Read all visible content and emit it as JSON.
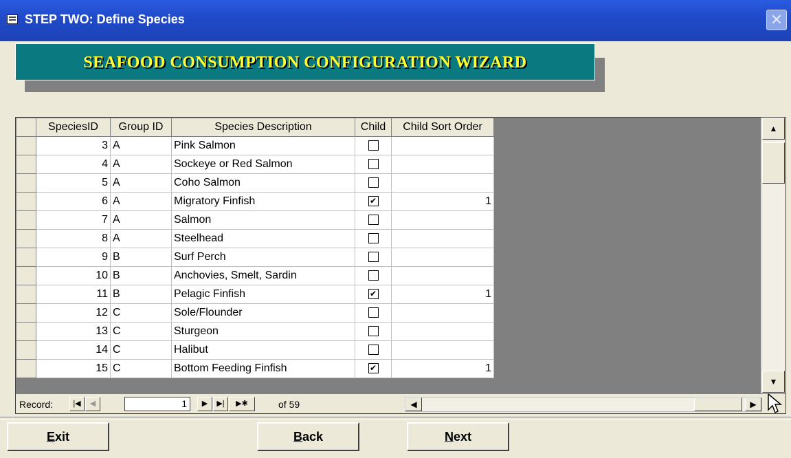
{
  "window": {
    "title": "STEP TWO:  Define Species",
    "close_label": "✕"
  },
  "banner": {
    "text": "SEAFOOD CONSUMPTION CONFIGURATION WIZARD"
  },
  "table": {
    "columns": [
      "SpeciesID",
      "Group ID",
      "Species Description",
      "Child",
      "Child Sort Order"
    ],
    "rows": [
      {
        "id": "3",
        "group": "A",
        "desc": "Pink Salmon",
        "child": false,
        "sort": ""
      },
      {
        "id": "4",
        "group": "A",
        "desc": "Sockeye or Red Salmon",
        "child": false,
        "sort": ""
      },
      {
        "id": "5",
        "group": "A",
        "desc": "Coho Salmon",
        "child": false,
        "sort": ""
      },
      {
        "id": "6",
        "group": "A",
        "desc": "Migratory Finfish",
        "child": true,
        "sort": "1"
      },
      {
        "id": "7",
        "group": "A",
        "desc": "Salmon",
        "child": false,
        "sort": ""
      },
      {
        "id": "8",
        "group": "A",
        "desc": "Steelhead",
        "child": false,
        "sort": ""
      },
      {
        "id": "9",
        "group": "B",
        "desc": "Surf Perch",
        "child": false,
        "sort": ""
      },
      {
        "id": "10",
        "group": "B",
        "desc": "Anchovies, Smelt, Sardin",
        "child": false,
        "sort": ""
      },
      {
        "id": "11",
        "group": "B",
        "desc": "Pelagic Finfish",
        "child": true,
        "sort": "1"
      },
      {
        "id": "12",
        "group": "C",
        "desc": "Sole/Flounder",
        "child": false,
        "sort": ""
      },
      {
        "id": "13",
        "group": "C",
        "desc": "Sturgeon",
        "child": false,
        "sort": ""
      },
      {
        "id": "14",
        "group": "C",
        "desc": "Halibut",
        "child": false,
        "sort": ""
      },
      {
        "id": "15",
        "group": "C",
        "desc": "Bottom Feeding Finfish",
        "child": true,
        "sort": "1"
      }
    ]
  },
  "navigator": {
    "record_label": "Record:",
    "current": "1",
    "of_text": "of 59",
    "first_icon": "first-record-icon",
    "prev_icon": "previous-record-icon",
    "next_icon": "next-record-icon",
    "last_icon": "last-record-icon",
    "new_icon": "new-record-icon"
  },
  "buttons": {
    "exit": {
      "mnemonic": "E",
      "rest": "xit"
    },
    "back": {
      "mnemonic": "B",
      "rest": "ack"
    },
    "next": {
      "mnemonic": "N",
      "rest": "ext"
    }
  }
}
